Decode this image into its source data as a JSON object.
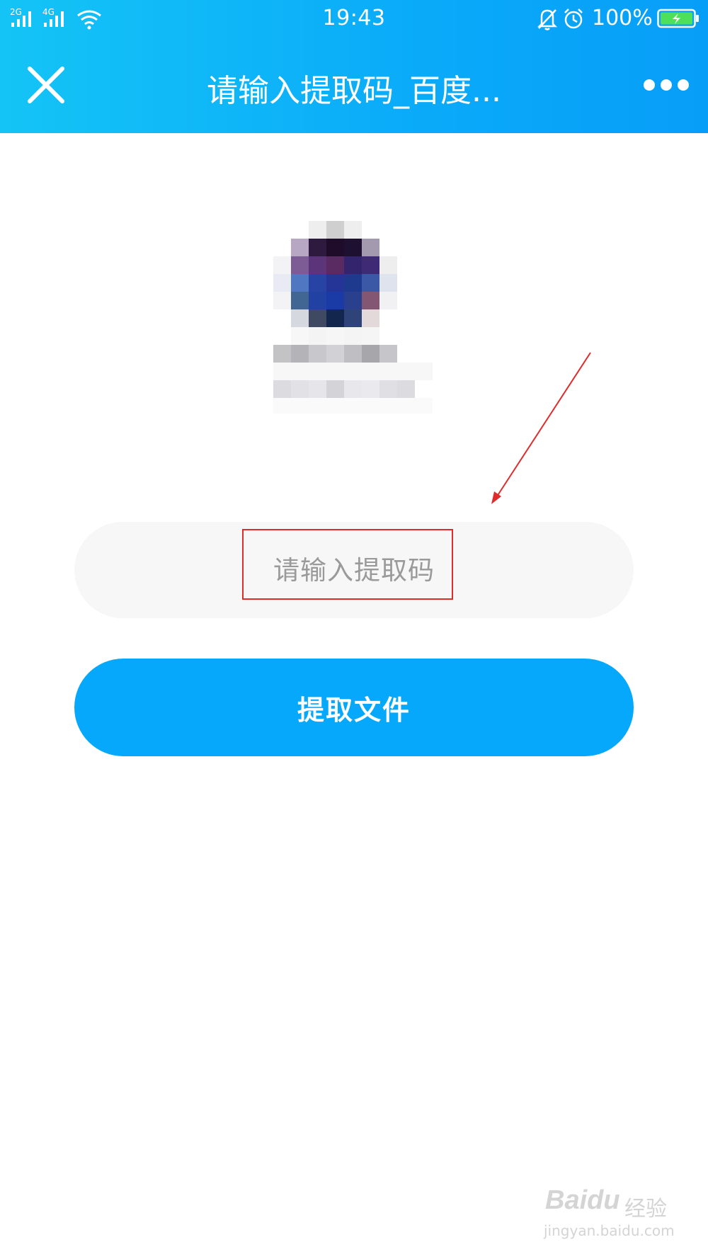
{
  "status_bar": {
    "signal_1_label": "2G",
    "signal_2_label": "4G",
    "time": "19:43",
    "battery_percent": "100%",
    "icons": [
      "signal-icon",
      "signal-icon",
      "wifi-icon",
      "silent-bell-icon",
      "alarm-icon",
      "battery-charging-icon"
    ]
  },
  "header": {
    "title": "请输入提取码_百度...",
    "close_icon": "close-icon",
    "more_icon": "more-dots-icon"
  },
  "form": {
    "code_input_placeholder": "请输入提取码",
    "code_input_value": "",
    "extract_button_label": "提取文件"
  },
  "watermark": {
    "brand": "Baidu",
    "suffix": "经验",
    "url": "jingyan.baidu.com"
  },
  "colors": {
    "header_start": "#14c4f6",
    "header_end": "#079ef8",
    "button": "#06a8fc",
    "input_bg": "#f7f7f7",
    "annotation": "#e02b2b"
  }
}
